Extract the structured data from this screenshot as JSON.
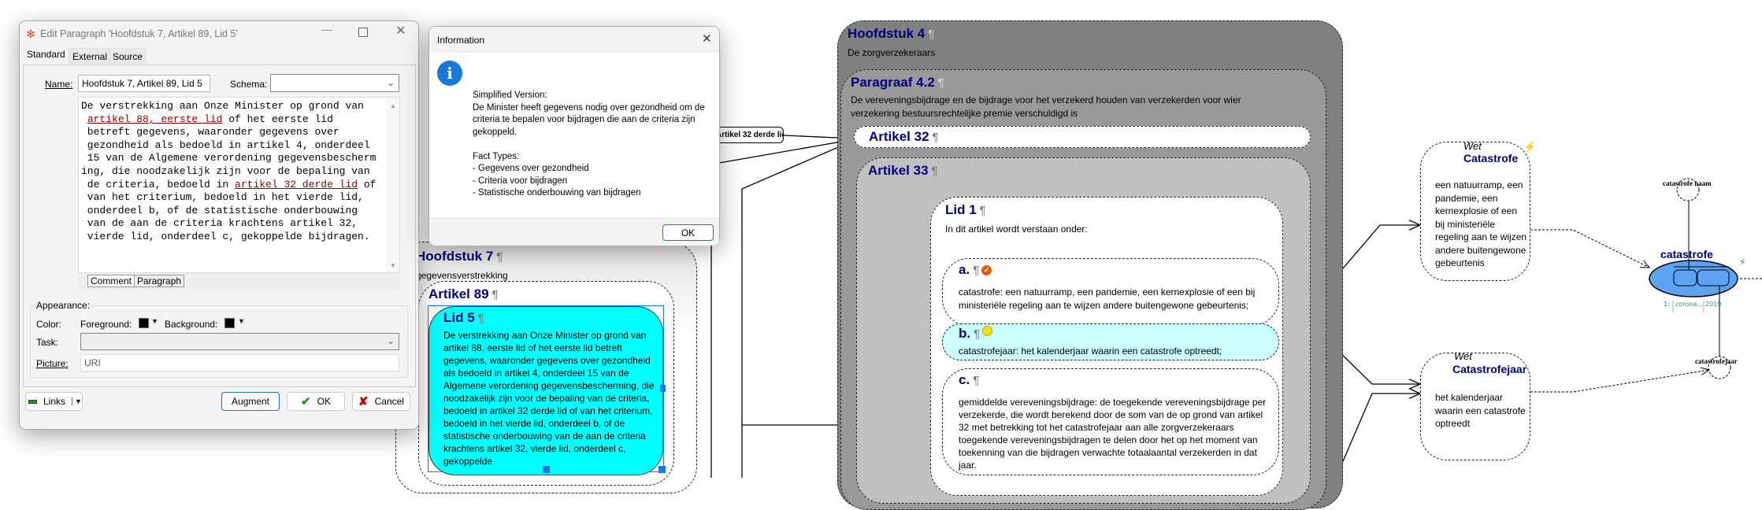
{
  "edit_dialog": {
    "title": "Edit Paragraph 'Hoofdstuk 7, Artikel 89, Lid 5'",
    "tabs": [
      "Standard",
      "External",
      "Source"
    ],
    "name_label": "Name:",
    "name_value": "Hoofdstuk 7, Artikel 89, Lid 5",
    "schema_label": "Schema:",
    "schema_value": "",
    "text_lines": [
      {
        "pre": "De verstrekking aan Onze Minister op grond van",
        "link": "",
        "post": ""
      },
      {
        "pre": " ",
        "link": "artikel 88, eerste lid",
        "post": " of het eerste lid"
      },
      {
        "pre": " betreft gegevens, waaronder gegevens over",
        "link": "",
        "post": ""
      },
      {
        "pre": " gezondheid als bedoeld in artikel 4, onderdeel",
        "link": "",
        "post": ""
      },
      {
        "pre": " 15 van de Algemene verordening gegevensbescherm",
        "link": "",
        "post": ""
      },
      {
        "pre": "ing, die noodzakelijk zijn voor de bepaling van",
        "link": "",
        "post": ""
      },
      {
        "pre": " de criteria, bedoeld in ",
        "link": "artikel 32 derde lid",
        "post": " of"
      },
      {
        "pre": " van het criterium, bedoeld in het vierde lid,",
        "link": "",
        "post": ""
      },
      {
        "pre": " onderdeel b, of de statistische onderbouwing",
        "link": "",
        "post": ""
      },
      {
        "pre": " van de aan de criteria krachtens artikel 32,",
        "link": "",
        "post": ""
      },
      {
        "pre": " vierde lid, onderdeel c, gekoppelde bijdragen.",
        "link": "",
        "post": ""
      }
    ],
    "subtabs": [
      "Comment",
      "Paragraph"
    ],
    "appearance_label": "Appearance:",
    "color_label": "Color:",
    "foreground_label": "Foreground:",
    "background_label": "Background:",
    "foreground_color": "#000000",
    "background_color": "#000000",
    "task_label": "Task:",
    "task_value": "",
    "picture_label": "Picture:",
    "picture_placeholder": "URI",
    "links_label": "Links",
    "augment_label": "Augment",
    "ok_label": "OK",
    "cancel_label": "Cancel"
  },
  "info_dialog": {
    "title": "Information",
    "icon": "info-icon",
    "lines": [
      "Simplified Version:",
      "De Minister heeft gegevens nodig over gezondheid om de",
      "criteria te bepalen voor bijdragen die aan de criteria zijn",
      "gekoppeld.",
      "",
      "Fact Types:",
      "- Gegevens over gezondheid",
      "- Criteria voor bijdragen",
      "- Statistische onderbouwing van bijdragen"
    ],
    "ok_label": "OK"
  },
  "diagram": {
    "hoofdstuk7": {
      "title": "Hoofdstuk 7",
      "text": "gegevensverstrekking"
    },
    "artikel89": {
      "title": "Artikel 89"
    },
    "lid5": {
      "title": "Lid 5",
      "text": "De verstrekking aan Onze Minister op grond van artikel 88, eerste lid of het eerste lid betreft gegevens, waaronder gegevens over gezondheid als bedoeld in artikel 4, onderdeel 15 van de Algemene verordening gegevensbescherming, die noodzakelijk zijn voor de bepaling van de criteria, bedoeld in artikel 32 derde lid of van het criterium, bedoeld in het vierde lid, onderdeel b, of de statistische onderbouwing van de aan de criteria krachtens artikel 32, vierde lid, onderdeel c, gekoppelde",
      "color": "#00ffff"
    },
    "link_label": "Artikel 32 derde lid",
    "hoofdstuk4": {
      "title": "Hoofdstuk 4",
      "text": "De zorgverzekeraars",
      "color": "#808080"
    },
    "paragraaf42": {
      "title": "Paragraaf 4.2",
      "text": "De vereveningsbijdrage en de bijdrage voor het verzekerd houden van verzekerden voor wier verzekering bestuursrechtelijke premie verschuldigd is",
      "color": "#999999"
    },
    "artikel32": {
      "title": "Artikel 32"
    },
    "artikel33": {
      "title": "Artikel 33",
      "color": "#c0c0c0"
    },
    "lid1": {
      "title": "Lid 1",
      "text": "In dit artikel wordt verstaan onder:"
    },
    "items": [
      {
        "title": "a.",
        "text": "catastrofe: een natuurramp, een pandemie, een kernexplosie of een bij ministeriële regeling aan te wijzen andere buitengewone gebeurtenis;",
        "status": "check-orange"
      },
      {
        "title": "b.",
        "text": "catastrofejaar: het kalenderjaar waarin een catastrofe optreedt;",
        "status": "pause-yellow",
        "color": "#ccffff"
      },
      {
        "title": "c.",
        "text": "gemiddelde vereveningsbijdrage: de toegekende vereveningsbijdrage per verzekerde, die wordt berekend door de som van de op grond van artikel 32 met betrekking tot het catastrofejaar aan alle zorgverzekeraars toegekende vereveningsbijdragen te delen door het op het moment van toekenning van die bijdragen verwachte totaalaantal verzekerden in dat jaar."
      }
    ],
    "wet_catastrofe": {
      "kind": "Wet",
      "title": "Catastrofe",
      "text": "een natuurramp, een pandemie, een kernexplosie of een bij ministeriële regeling aan te wijzen andere buitengewone gebeurtenis"
    },
    "wet_catastrofejaar": {
      "kind": "Wet",
      "title": "Catastrofejaar",
      "text": "het kalenderjaar waarin een catastrofe optreedt"
    },
    "fact_type": {
      "title": "catastrofe",
      "color": "#5ea2f2",
      "row_label": "1:",
      "cells": [
        "corona...",
        "2019"
      ],
      "role_naam": "catastrofe naam",
      "role_jaar": "catastrofejaar"
    }
  }
}
